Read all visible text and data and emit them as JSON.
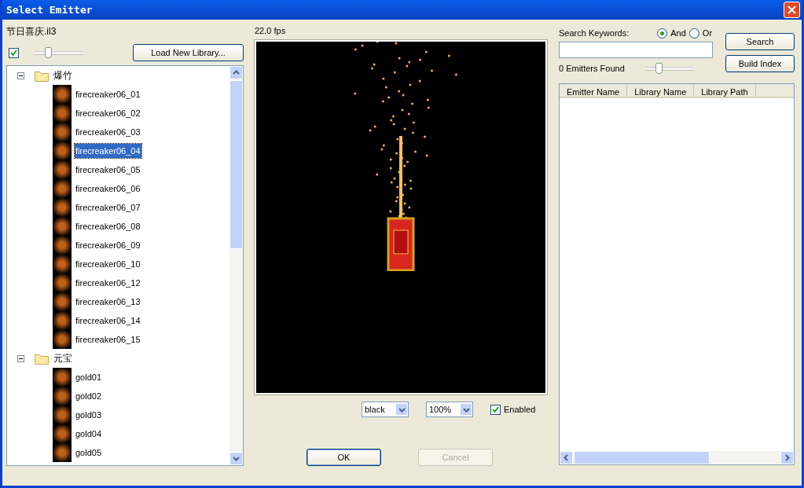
{
  "window": {
    "title": "Select Emitter"
  },
  "library": {
    "file": "节日喜庆.il3",
    "show_thumbnails": true,
    "thumb_size": {
      "level": 0.27
    },
    "load_button": "Load New Library..."
  },
  "tree": [
    {
      "label": "爆竹",
      "expanded": true,
      "children": [
        {
          "label": "firecreaker06_01",
          "selected": false
        },
        {
          "label": "firecreaker06_02",
          "selected": false
        },
        {
          "label": "firecreaker06_03",
          "selected": false
        },
        {
          "label": "firecreaker06_04",
          "selected": true
        },
        {
          "label": "firecreaker06_05",
          "selected": false
        },
        {
          "label": "firecreaker06_06",
          "selected": false
        },
        {
          "label": "firecreaker06_07",
          "selected": false
        },
        {
          "label": "firecreaker06_08",
          "selected": false
        },
        {
          "label": "firecreaker06_09",
          "selected": false
        },
        {
          "label": "firecreaker06_10",
          "selected": false
        },
        {
          "label": "firecreaker06_12",
          "selected": false
        },
        {
          "label": "firecreaker06_13",
          "selected": false
        },
        {
          "label": "firecreaker06_14",
          "selected": false
        },
        {
          "label": "firecreaker06_15",
          "selected": false
        }
      ]
    },
    {
      "label": "元宝",
      "expanded": true,
      "children": [
        {
          "label": "gold01",
          "selected": false
        },
        {
          "label": "gold02",
          "selected": false
        },
        {
          "label": "gold03",
          "selected": false
        },
        {
          "label": "gold04",
          "selected": false
        },
        {
          "label": "gold05",
          "selected": false
        }
      ]
    }
  ],
  "preview": {
    "fps": "22.0 fps",
    "background": "black",
    "zoom": "100%",
    "enabled": true,
    "enabled_label": "Enabled"
  },
  "buttons": [
    {
      "label": "OK",
      "disabled": false,
      "default": true
    },
    {
      "label": "Cancel",
      "disabled": true,
      "default": false
    }
  ],
  "search": {
    "label": "Search Keywords:",
    "modes": [
      {
        "label": "And",
        "selected": true
      },
      {
        "label": "Or",
        "selected": false
      }
    ],
    "button": "Search",
    "found": "0 Emitters Found",
    "slider": {
      "level": 0.27
    },
    "index_button": "Build Index"
  },
  "results": {
    "columns": [
      "Emitter Name",
      "Library Name",
      "Library Path"
    ]
  }
}
